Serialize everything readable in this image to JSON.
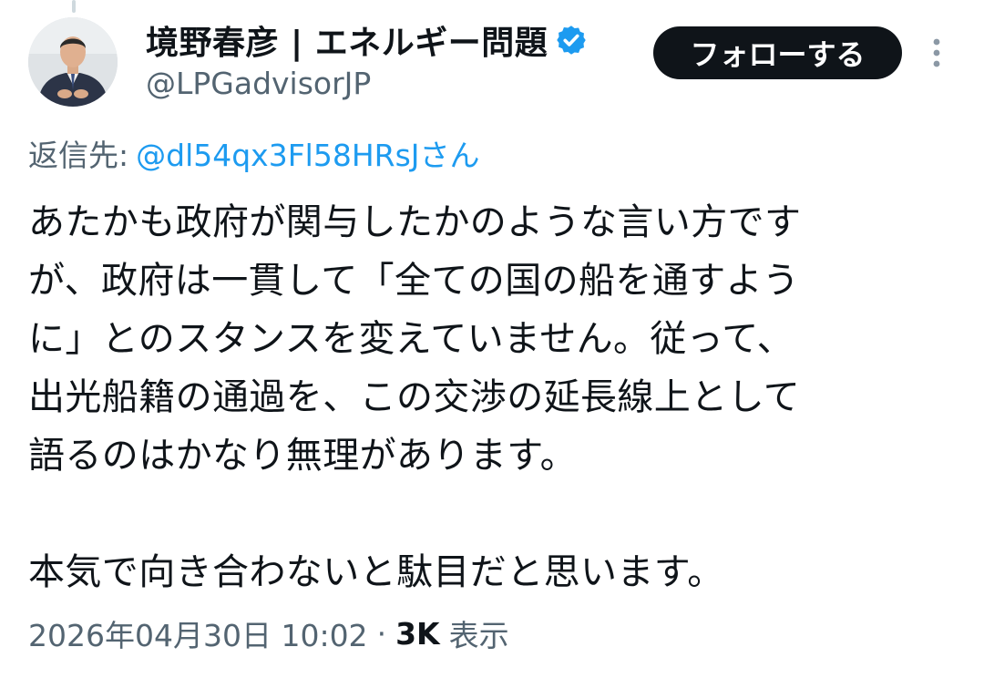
{
  "author": {
    "display_name": "境野春彦 | エネルギー問題",
    "handle": "@LPGadvisorJP",
    "verified": true
  },
  "actions": {
    "follow_label": "フォローする",
    "more_icon": "more-vertical-icon"
  },
  "reply": {
    "prefix": "返信先:",
    "mention": "@dl54qx3Fl58HRsJさん"
  },
  "tweet": {
    "lines": [
      "あたかも政府が関与したかのような言い方です",
      "が、政府は一貫して「全ての国の船を通すよう",
      "に」とのスタンスを変えていません。従って、",
      "出光船籍の通過を、この交渉の延長線上として",
      "語るのはかなり無理があります。",
      "",
      "本気で向き合わないと駄目だと思います。"
    ]
  },
  "meta": {
    "timestamp": "2026年04月30日 10:02",
    "separator": "·",
    "views_count": "3K",
    "views_label": "表示"
  },
  "colors": {
    "text": "#0f1419",
    "secondary": "#536471",
    "link": "#1d9bf0",
    "verified": "#1d9bf0",
    "follow_bg": "#0f1419"
  }
}
